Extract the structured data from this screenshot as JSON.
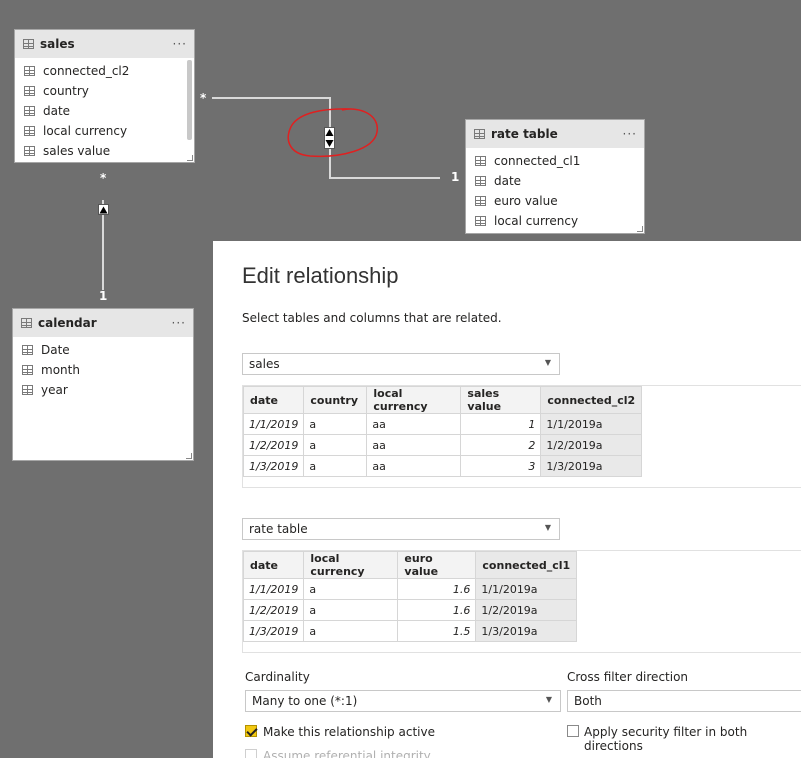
{
  "tables": {
    "sales": {
      "name": "sales",
      "more": "···",
      "fields": [
        "connected_cl2",
        "country",
        "date",
        "local currency",
        "sales value"
      ]
    },
    "rate_table": {
      "name": "rate table",
      "more": "···",
      "fields": [
        "connected_cl1",
        "date",
        "euro value",
        "local currency"
      ]
    },
    "calendar": {
      "name": "calendar",
      "more": "···",
      "fields": [
        "Date",
        "month",
        "year"
      ]
    }
  },
  "relationships": {
    "sales_rate": {
      "from_mark": "*",
      "to_mark": "1"
    },
    "sales_calendar": {
      "from_mark": "*",
      "to_mark": "1"
    }
  },
  "annotation_color": "#e02020",
  "dialog": {
    "title": "Edit relationship",
    "subtitle": "Select tables and columns that are related.",
    "table1": {
      "selected": "sales",
      "columns": [
        "date",
        "country",
        "local currency",
        "sales value",
        "connected_cl2"
      ],
      "rows": [
        [
          "1/1/2019",
          "a",
          "aa",
          "1",
          "1/1/2019a"
        ],
        [
          "1/2/2019",
          "a",
          "aa",
          "2",
          "1/2/2019a"
        ],
        [
          "1/3/2019",
          "a",
          "aa",
          "3",
          "1/3/2019a"
        ]
      ]
    },
    "table2": {
      "selected": "rate table",
      "columns": [
        "date",
        "local currency",
        "euro value",
        "connected_cl1"
      ],
      "rows": [
        [
          "1/1/2019",
          "a",
          "1.6",
          "1/1/2019a"
        ],
        [
          "1/2/2019",
          "a",
          "1.6",
          "1/2/2019a"
        ],
        [
          "1/3/2019",
          "a",
          "1.5",
          "1/3/2019a"
        ]
      ]
    },
    "cardinality": {
      "label": "Cardinality",
      "value": "Many to one (*:1)"
    },
    "cross_filter": {
      "label": "Cross filter direction",
      "value": "Both"
    },
    "active": {
      "label": "Make this relationship active",
      "checked": true
    },
    "security": {
      "label": "Apply security filter in both directions",
      "checked": false
    },
    "referential": {
      "label": "Assume referential integrity",
      "checked": false
    }
  }
}
